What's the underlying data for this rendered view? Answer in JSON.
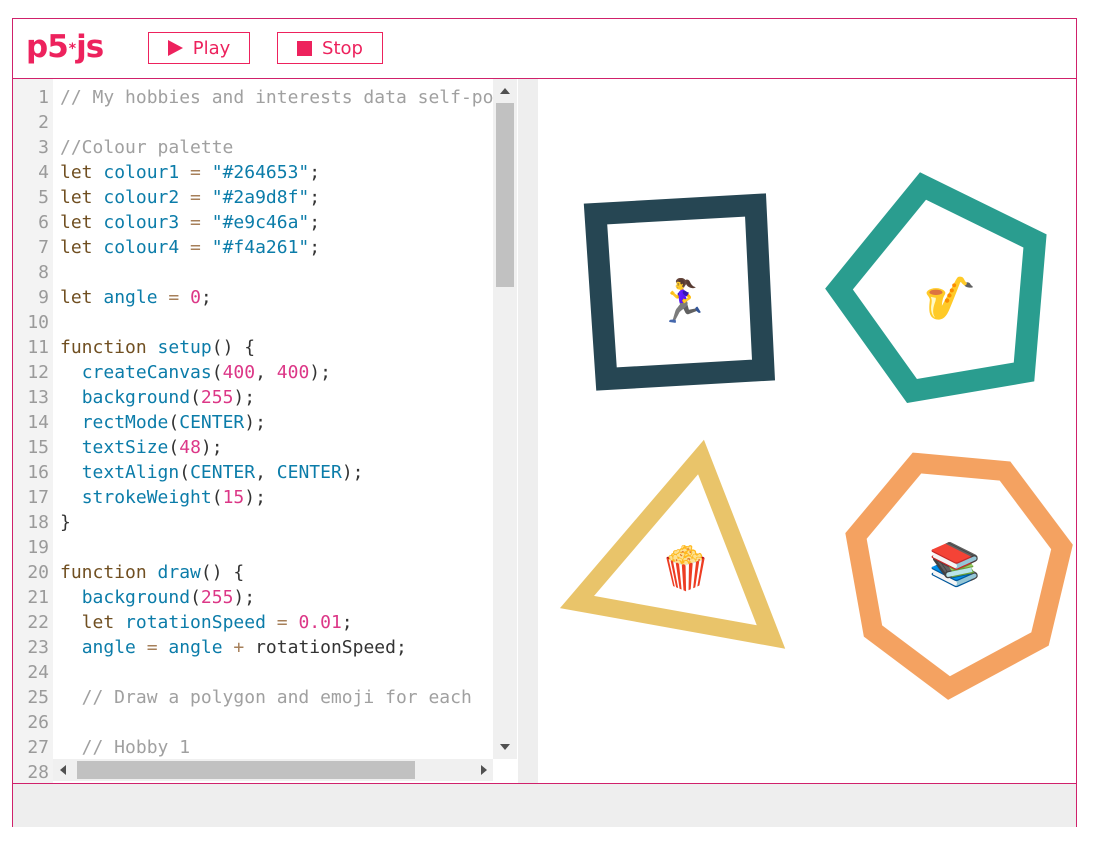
{
  "toolbar": {
    "logo_main": "p5",
    "logo_star": "*",
    "logo_suffix": "js",
    "play_label": "Play",
    "stop_label": "Stop"
  },
  "editor": {
    "lines": [
      {
        "n": "1",
        "tokens": [
          {
            "t": "// My hobbies and interests data self-portrait",
            "c": "com"
          }
        ]
      },
      {
        "n": "2",
        "tokens": []
      },
      {
        "n": "3",
        "tokens": [
          {
            "t": "//Colour palette",
            "c": "com"
          }
        ]
      },
      {
        "n": "4",
        "tokens": [
          {
            "t": "let ",
            "c": "kw"
          },
          {
            "t": "colour1",
            "c": "var"
          },
          {
            "t": " = ",
            "c": "op"
          },
          {
            "t": "\"#264653\"",
            "c": "str"
          },
          {
            "t": ";",
            "c": "p"
          }
        ]
      },
      {
        "n": "5",
        "tokens": [
          {
            "t": "let ",
            "c": "kw"
          },
          {
            "t": "colour2",
            "c": "var"
          },
          {
            "t": " = ",
            "c": "op"
          },
          {
            "t": "\"#2a9d8f\"",
            "c": "str"
          },
          {
            "t": ";",
            "c": "p"
          }
        ]
      },
      {
        "n": "6",
        "tokens": [
          {
            "t": "let ",
            "c": "kw"
          },
          {
            "t": "colour3",
            "c": "var"
          },
          {
            "t": " = ",
            "c": "op"
          },
          {
            "t": "\"#e9c46a\"",
            "c": "str"
          },
          {
            "t": ";",
            "c": "p"
          }
        ]
      },
      {
        "n": "7",
        "tokens": [
          {
            "t": "let ",
            "c": "kw"
          },
          {
            "t": "colour4",
            "c": "var"
          },
          {
            "t": " = ",
            "c": "op"
          },
          {
            "t": "\"#f4a261\"",
            "c": "str"
          },
          {
            "t": ";",
            "c": "p"
          }
        ]
      },
      {
        "n": "8",
        "tokens": []
      },
      {
        "n": "9",
        "tokens": [
          {
            "t": "let ",
            "c": "kw"
          },
          {
            "t": "angle",
            "c": "var"
          },
          {
            "t": " = ",
            "c": "op"
          },
          {
            "t": "0",
            "c": "num"
          },
          {
            "t": ";",
            "c": "p"
          }
        ]
      },
      {
        "n": "10",
        "tokens": []
      },
      {
        "n": "11",
        "tokens": [
          {
            "t": "function ",
            "c": "kw"
          },
          {
            "t": "setup",
            "c": "fn"
          },
          {
            "t": "() {",
            "c": "p"
          }
        ]
      },
      {
        "n": "12",
        "tokens": [
          {
            "t": "  ",
            "c": "p"
          },
          {
            "t": "createCanvas",
            "c": "fn"
          },
          {
            "t": "(",
            "c": "p"
          },
          {
            "t": "400",
            "c": "num"
          },
          {
            "t": ", ",
            "c": "p"
          },
          {
            "t": "400",
            "c": "num"
          },
          {
            "t": ");",
            "c": "p"
          }
        ]
      },
      {
        "n": "13",
        "tokens": [
          {
            "t": "  ",
            "c": "p"
          },
          {
            "t": "background",
            "c": "fn"
          },
          {
            "t": "(",
            "c": "p"
          },
          {
            "t": "255",
            "c": "num"
          },
          {
            "t": ");",
            "c": "p"
          }
        ]
      },
      {
        "n": "14",
        "tokens": [
          {
            "t": "  ",
            "c": "p"
          },
          {
            "t": "rectMode",
            "c": "fn"
          },
          {
            "t": "(",
            "c": "p"
          },
          {
            "t": "CENTER",
            "c": "var"
          },
          {
            "t": ");",
            "c": "p"
          }
        ]
      },
      {
        "n": "15",
        "tokens": [
          {
            "t": "  ",
            "c": "p"
          },
          {
            "t": "textSize",
            "c": "fn"
          },
          {
            "t": "(",
            "c": "p"
          },
          {
            "t": "48",
            "c": "num"
          },
          {
            "t": ");",
            "c": "p"
          }
        ]
      },
      {
        "n": "16",
        "tokens": [
          {
            "t": "  ",
            "c": "p"
          },
          {
            "t": "textAlign",
            "c": "fn"
          },
          {
            "t": "(",
            "c": "p"
          },
          {
            "t": "CENTER",
            "c": "var"
          },
          {
            "t": ", ",
            "c": "p"
          },
          {
            "t": "CENTER",
            "c": "var"
          },
          {
            "t": ");",
            "c": "p"
          }
        ]
      },
      {
        "n": "17",
        "tokens": [
          {
            "t": "  ",
            "c": "p"
          },
          {
            "t": "strokeWeight",
            "c": "fn"
          },
          {
            "t": "(",
            "c": "p"
          },
          {
            "t": "15",
            "c": "num"
          },
          {
            "t": ");",
            "c": "p"
          }
        ]
      },
      {
        "n": "18",
        "tokens": [
          {
            "t": "}",
            "c": "p"
          }
        ]
      },
      {
        "n": "19",
        "tokens": []
      },
      {
        "n": "20",
        "tokens": [
          {
            "t": "function ",
            "c": "kw"
          },
          {
            "t": "draw",
            "c": "fn"
          },
          {
            "t": "() {",
            "c": "p"
          }
        ]
      },
      {
        "n": "21",
        "tokens": [
          {
            "t": "  ",
            "c": "p"
          },
          {
            "t": "background",
            "c": "fn"
          },
          {
            "t": "(",
            "c": "p"
          },
          {
            "t": "255",
            "c": "num"
          },
          {
            "t": ");",
            "c": "p"
          }
        ]
      },
      {
        "n": "22",
        "tokens": [
          {
            "t": "  let ",
            "c": "kw"
          },
          {
            "t": "rotationSpeed",
            "c": "var"
          },
          {
            "t": " = ",
            "c": "op"
          },
          {
            "t": "0.01",
            "c": "num"
          },
          {
            "t": ";",
            "c": "p"
          }
        ]
      },
      {
        "n": "23",
        "tokens": [
          {
            "t": "  ",
            "c": "p"
          },
          {
            "t": "angle",
            "c": "var"
          },
          {
            "t": " = ",
            "c": "op"
          },
          {
            "t": "angle",
            "c": "var"
          },
          {
            "t": " + ",
            "c": "op"
          },
          {
            "t": "rotationSpeed;",
            "c": "p"
          }
        ]
      },
      {
        "n": "24",
        "tokens": []
      },
      {
        "n": "25",
        "tokens": [
          {
            "t": "  // Draw a polygon and emoji for each",
            "c": "com"
          }
        ]
      },
      {
        "n": "26",
        "tokens": []
      },
      {
        "n": "27",
        "tokens": [
          {
            "t": "  // Hobby 1",
            "c": "com"
          }
        ]
      },
      {
        "n": "28",
        "tokens": []
      }
    ]
  },
  "canvas": {
    "shapes": [
      {
        "name": "square",
        "color": "#264653",
        "emoji": "🏃‍♀️",
        "icon": "running-woman-icon"
      },
      {
        "name": "pentagon",
        "color": "#2a9d8f",
        "emoji": "🎷",
        "icon": "saxophone-icon"
      },
      {
        "name": "triangle",
        "color": "#e9c46a",
        "emoji": "🍿",
        "icon": "popcorn-icon"
      },
      {
        "name": "heptagon",
        "color": "#f4a261",
        "emoji": "📚",
        "icon": "books-icon"
      }
    ]
  },
  "colors": {
    "accent": "#ed225d",
    "border": "#d0216b"
  }
}
